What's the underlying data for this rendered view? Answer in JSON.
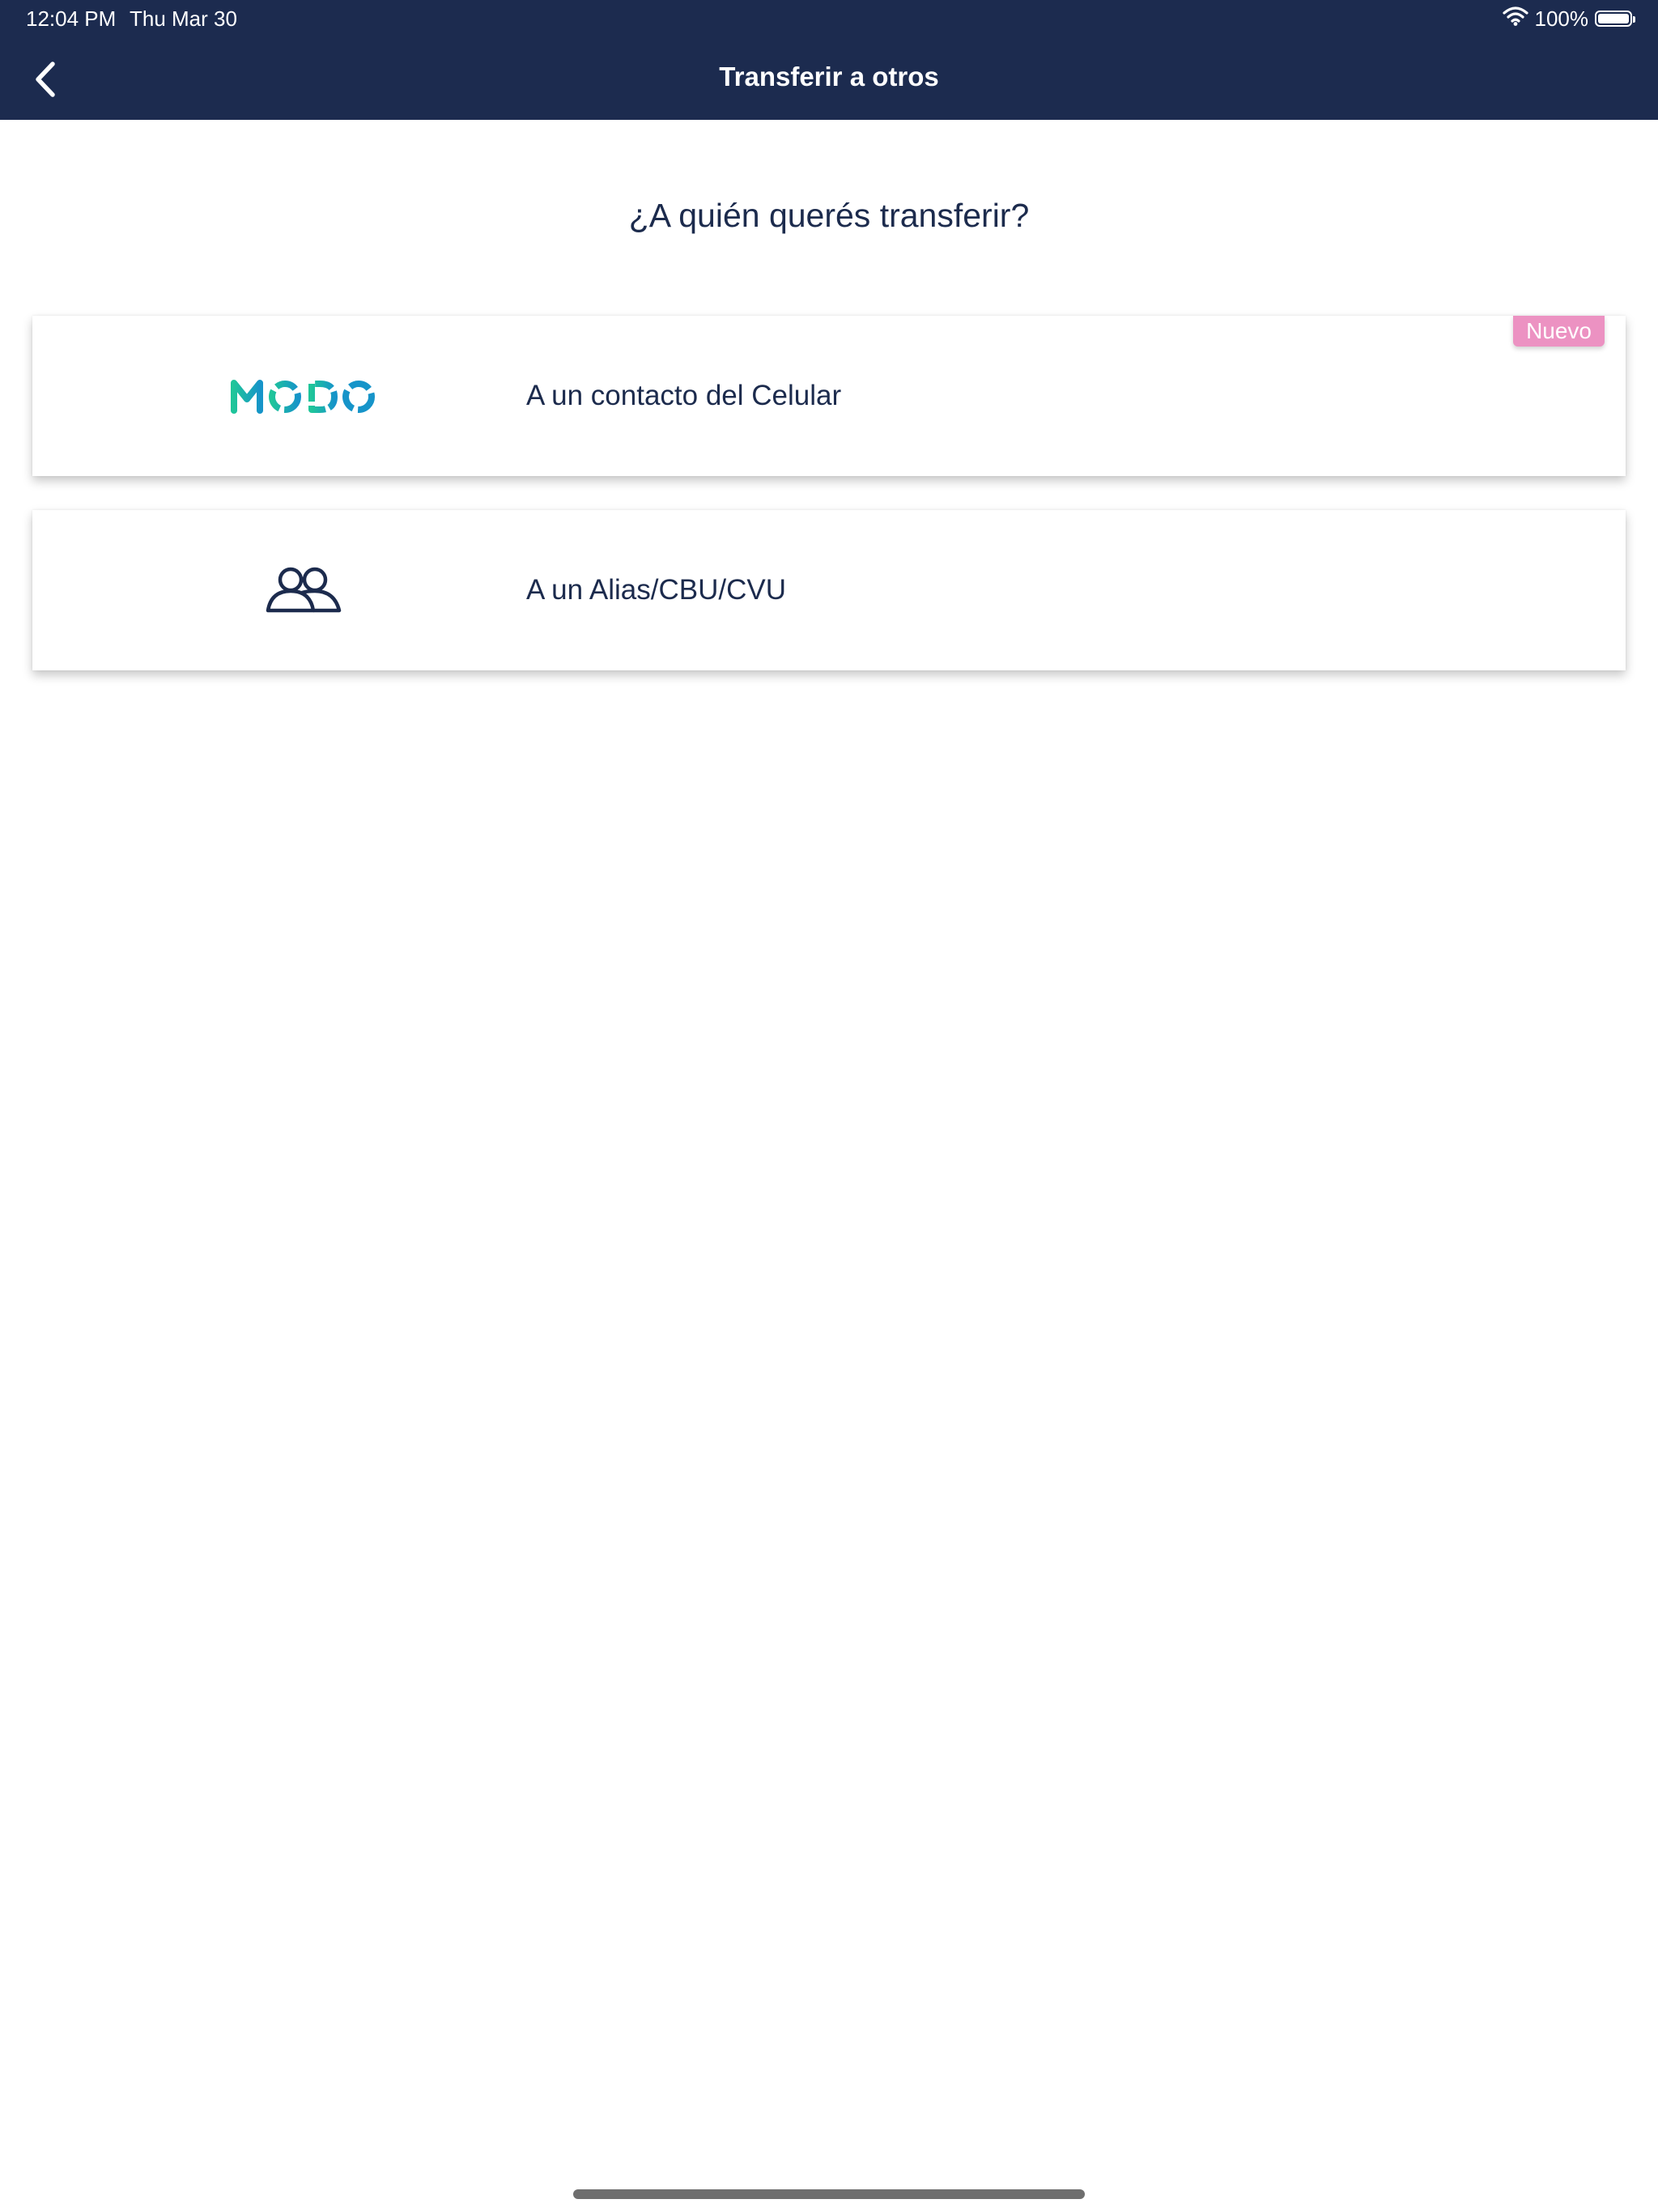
{
  "status_bar": {
    "time": "12:04 PM",
    "date": "Thu Mar 30",
    "battery_text": "100%",
    "battery_level": 1.0
  },
  "header": {
    "title": "Transferir a otros",
    "background": "#1c2b4f"
  },
  "main": {
    "question": "¿A quién querés transferir?",
    "options": [
      {
        "icon": "modo-logo",
        "logo_text": "MODO",
        "label": "A un contacto del Celular",
        "badge": "Nuevo",
        "badge_color": "#ec92c2"
      },
      {
        "icon": "people-icon",
        "label": "A un Alias/CBU/CVU"
      }
    ]
  },
  "colors": {
    "primary_text": "#1c2b4d",
    "modo_green": "#1fc59a",
    "modo_blue": "#1694c9"
  }
}
